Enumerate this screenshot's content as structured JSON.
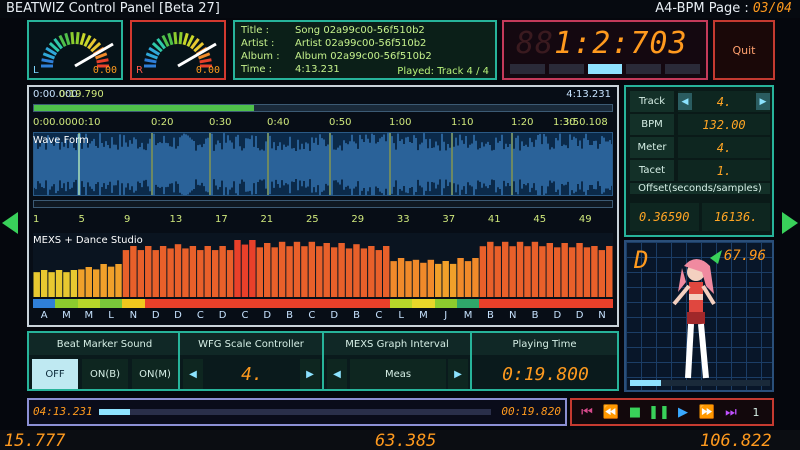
{
  "app": {
    "title": "BEATWIZ Control Panel [Beta 27]",
    "page_label": "A4-BPM Page : ",
    "page_value": "03/04"
  },
  "gauges": {
    "left": {
      "label": "L",
      "value": "0.00"
    },
    "right": {
      "label": "R",
      "value": "0.00"
    }
  },
  "song": {
    "title_key": "Title :",
    "title": "Song 02a99c00-56f510b2",
    "artist_key": "Artist :",
    "artist": "Artist 02a99c00-56f510b2",
    "album_key": "Album :",
    "album": "Album 02a99c00-56f510b2",
    "time_key": "Time :",
    "time": "4:13.231",
    "played": "Played: Track 4 / 4"
  },
  "clock": {
    "ghost": "88",
    "value": "1:2:703"
  },
  "quit_label": "Quit",
  "timeline": {
    "start": "0:00.000",
    "cursor": "0:19.790",
    "end": "4:13.231",
    "ticks": [
      "0:00.000",
      "0:10",
      "0:20",
      "0:30",
      "0:40",
      "0:50",
      "1:00",
      "1:10",
      "1:20",
      "1:30",
      "3:50.108"
    ],
    "progress_pct": 38
  },
  "waveform_label": "Wave Form",
  "beat_ticks": [
    "1",
    "5",
    "9",
    "13",
    "17",
    "21",
    "25",
    "29",
    "33",
    "37",
    "41",
    "45",
    "49"
  ],
  "mexs_label": "MEXS + Dance Studio",
  "mexs_letters": [
    "A",
    "M",
    "M",
    "L",
    "N",
    "D",
    "D",
    "C",
    "D",
    "C",
    "D",
    "B",
    "C",
    "D",
    "B",
    "C",
    "L",
    "M",
    "J",
    "M",
    "B",
    "N",
    "B",
    "D",
    "D",
    "N"
  ],
  "mexs_levels": [
    0.45,
    0.45,
    0.5,
    0.55,
    0.85,
    0.85,
    0.88,
    0.85,
    0.85,
    0.95,
    0.9,
    0.92,
    0.92,
    0.9,
    0.88,
    0.85,
    0.65,
    0.62,
    0.6,
    0.65,
    0.92,
    0.92,
    0.92,
    0.9,
    0.9,
    0.85
  ],
  "mexs_colors": [
    "#2f7fd8",
    "#8ccc2e",
    "#b8d62a",
    "#7ac83a",
    "#f0c81e",
    "#e8402a",
    "#e8402a",
    "#e8402a",
    "#e8402a",
    "#e8402a",
    "#e8402a",
    "#e8402a",
    "#e8402a",
    "#e8402a",
    "#e8402a",
    "#e8402a",
    "#b8d62a",
    "#e8d62a",
    "#8ccc2e",
    "#2fa86a",
    "#e8402a",
    "#e8402a",
    "#e8402a",
    "#e8402a",
    "#e8402a",
    "#e8402a"
  ],
  "right_panel": {
    "track_label": "Track",
    "track_value": "4.",
    "bpm_label": "BPM",
    "bpm_value": "132.00",
    "meter_label": "Meter",
    "meter_value": "4.",
    "tacet_label": "Tacet",
    "tacet_value": "1.",
    "offset_label": "Offset(seconds/samples)",
    "offset_seconds": "0.36590",
    "offset_samples": "16136."
  },
  "character": {
    "initial": "D",
    "score": "67.96"
  },
  "controls": {
    "beat_marker": {
      "header": "Beat Marker Sound",
      "off": "OFF",
      "on_b": "ON(B)",
      "on_m": "ON(M)"
    },
    "wfg": {
      "header": "WFG Scale Controller",
      "value": "4."
    },
    "mexs_interval": {
      "header": "MEXS Graph Interval",
      "value": "Meas"
    },
    "playing_time": {
      "header": "Playing Time",
      "value": "0:19.800"
    }
  },
  "seek": {
    "total": "04:13.231",
    "current": "00:19.820",
    "progress_pct": 8
  },
  "transport": {
    "track_number": "1"
  },
  "bottom_numbers": {
    "left": "15.777",
    "center": "63.385",
    "right": "106.822"
  },
  "colors": {
    "accent": "#ff9a1e",
    "teal": "#27b39a",
    "red": "#d2392f"
  }
}
